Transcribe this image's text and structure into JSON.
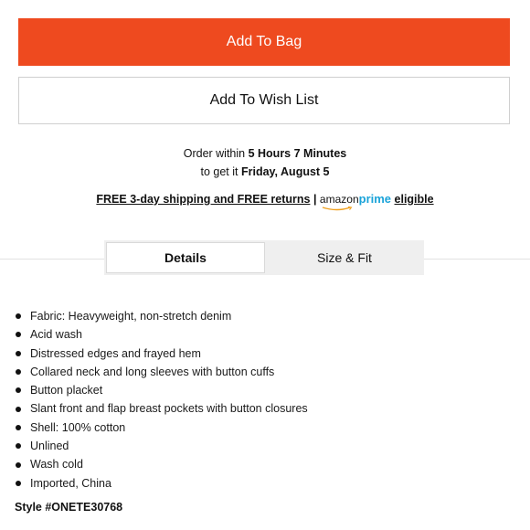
{
  "actions": {
    "add_to_bag": "Add To Bag",
    "add_to_wish_list": "Add To Wish List"
  },
  "delivery": {
    "order_within_prefix": "Order within ",
    "order_within_time": "5 Hours 7 Minutes",
    "get_it_prefix": "to get it ",
    "get_it_date": "Friday, August 5"
  },
  "shipping": {
    "link_text": "FREE 3-day shipping and FREE returns",
    "separator": "|",
    "prime_amazon": "amazon",
    "prime_word": "prime",
    "eligible": "eligible"
  },
  "tabs": [
    {
      "label": "Details",
      "active": true
    },
    {
      "label": "Size & Fit",
      "active": false
    }
  ],
  "details": [
    "Fabric: Heavyweight, non-stretch denim",
    "Acid wash",
    "Distressed edges and frayed hem",
    "Collared neck and long sleeves with button cuffs",
    "Button placket",
    "Slant front and flap breast pockets with button closures",
    "Shell: 100% cotton",
    "Unlined",
    "Wash cold",
    "Imported, China"
  ],
  "style_code": "Style #ONETE30768",
  "colors": {
    "primary_button": "#ee4a1f",
    "prime_blue": "#1aa3d9"
  }
}
